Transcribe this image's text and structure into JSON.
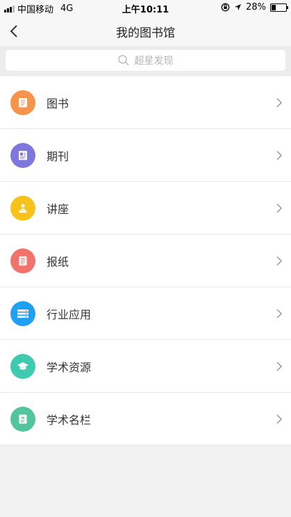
{
  "status": {
    "carrier": "中国移动",
    "network": "4G",
    "time": "上午10:11",
    "battery_pct": "28%",
    "battery_level": 0.28
  },
  "nav": {
    "title": "我的图书馆",
    "back_icon": "chevron-left-icon"
  },
  "search": {
    "placeholder": "超星发现",
    "icon": "search-icon"
  },
  "items": [
    {
      "label": "图书",
      "icon": "book-icon",
      "color": "#f5944a"
    },
    {
      "label": "期刊",
      "icon": "journal-icon",
      "color": "#7f77de"
    },
    {
      "label": "讲座",
      "icon": "lecture-icon",
      "color": "#f7c21a"
    },
    {
      "label": "报纸",
      "icon": "newspaper-icon",
      "color": "#f2736b"
    },
    {
      "label": "行业应用",
      "icon": "industry-icon",
      "color": "#1fa0f2"
    },
    {
      "label": "学术资源",
      "icon": "graduation-cap-icon",
      "color": "#3fcbb0"
    },
    {
      "label": "学术名栏",
      "icon": "column-icon",
      "color": "#53c59a"
    }
  ]
}
